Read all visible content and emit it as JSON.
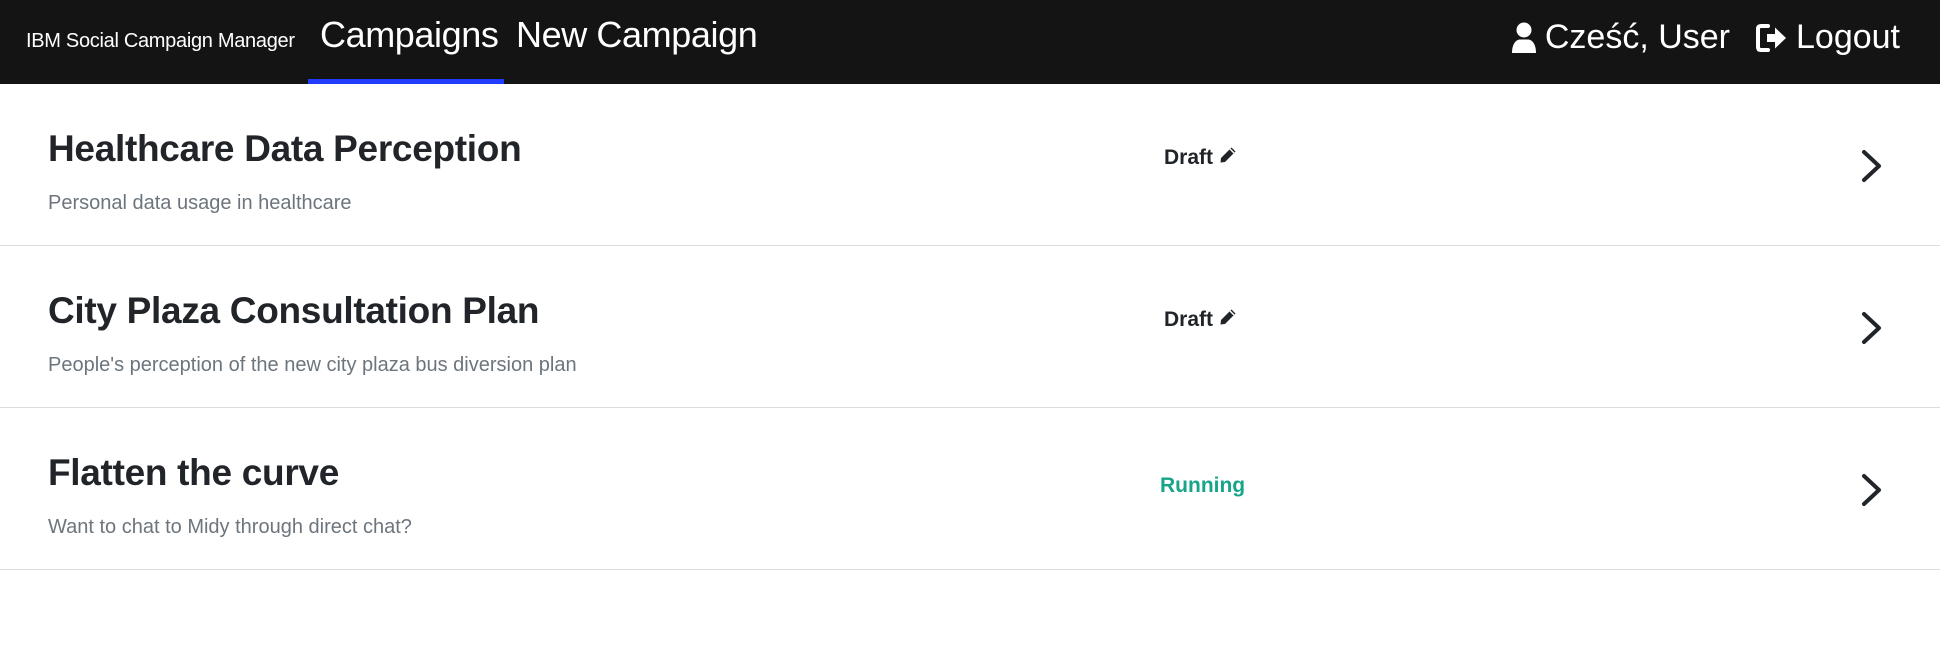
{
  "header": {
    "brand": "IBM Social Campaign Manager",
    "tabs": [
      {
        "label": "Campaigns",
        "active": true
      },
      {
        "label": "New Campaign",
        "active": false
      }
    ],
    "greeting": "Cześć, User",
    "logout_label": "Logout",
    "user_icon": "user-icon",
    "logout_icon": "logout-icon",
    "accent_color": "#1f3cff",
    "bar_color": "#141414"
  },
  "campaigns": [
    {
      "title": "Healthcare Data Perception",
      "description": "Personal data usage in healthcare",
      "status": "Draft",
      "status_icon": "pencil-icon"
    },
    {
      "title": "City Plaza Consultation Plan",
      "description": "People's perception of the new city plaza bus diversion plan",
      "status": "Draft",
      "status_icon": "pencil-icon"
    },
    {
      "title": "Flatten the curve",
      "description": "Want to chat to Midy through direct chat?",
      "status": "Running",
      "status_color": "#17a589"
    }
  ]
}
